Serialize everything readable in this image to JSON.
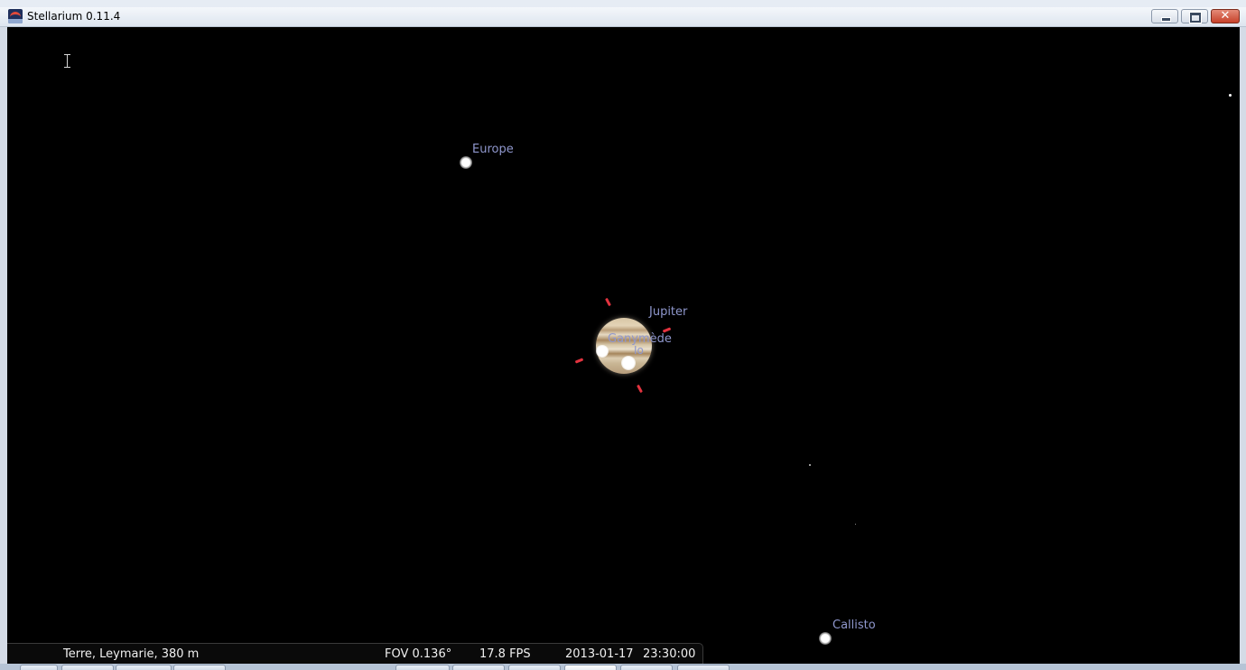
{
  "window": {
    "title": "Stellarium 0.11.4",
    "controls": {
      "minimize": "minimize",
      "maximize": "maximize",
      "close": "✕"
    }
  },
  "sky": {
    "objects": {
      "europe": "Europe",
      "jupiter": "Jupiter",
      "ganymede": "Ganymède",
      "io": "Io",
      "callisto": "Callisto"
    }
  },
  "status": {
    "location": "Terre, Leymarie, 380 m",
    "fov": "FOV 0.136°",
    "fps": "17.8 FPS",
    "date": "2013-01-17",
    "time": "23:30:00"
  },
  "colors": {
    "label": "#8f97cd",
    "reticle": "#e2333f",
    "sky": "#000000"
  }
}
